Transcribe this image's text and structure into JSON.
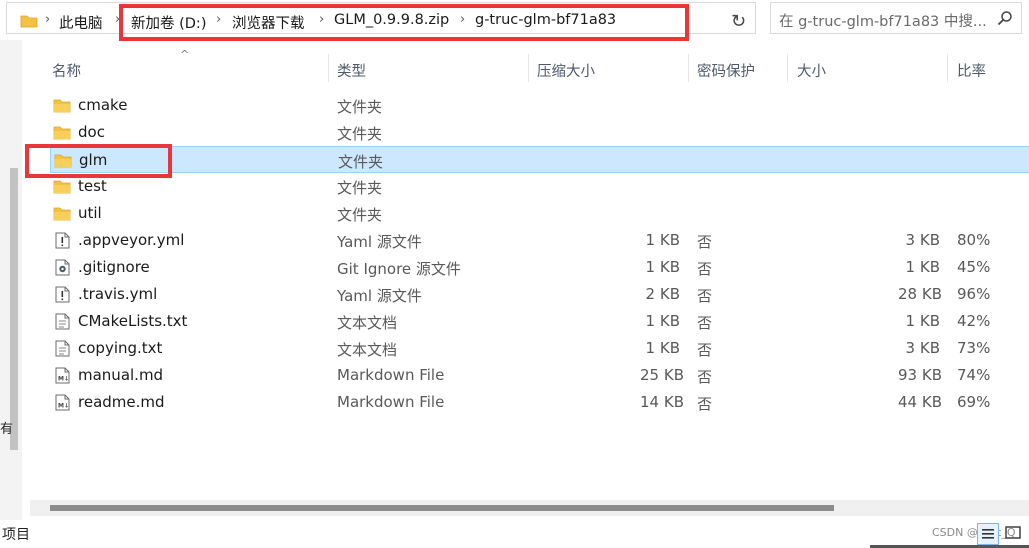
{
  "address": {
    "root": "此电脑",
    "crumbs": [
      "新加卷 (D:)",
      "浏览器下载",
      "GLM_0.9.9.8.zip",
      "g-truc-glm-bf71a83"
    ]
  },
  "search": {
    "placeholder": "在 g-truc-glm-bf71a83 中搜..."
  },
  "columns": {
    "name": "名称",
    "type": "类型",
    "compressed": "压缩大小",
    "password": "密码保护",
    "size": "大小",
    "ratio": "比率"
  },
  "rows": [
    {
      "name": "cmake",
      "type": "文件夹",
      "csize": "",
      "pw": "",
      "size": "",
      "ratio": "",
      "icon": "folder-icon"
    },
    {
      "name": "doc",
      "type": "文件夹",
      "csize": "",
      "pw": "",
      "size": "",
      "ratio": "",
      "icon": "folder-icon"
    },
    {
      "name": "glm",
      "type": "文件夹",
      "csize": "",
      "pw": "",
      "size": "",
      "ratio": "",
      "icon": "folder-icon",
      "selected": true
    },
    {
      "name": "test",
      "type": "文件夹",
      "csize": "",
      "pw": "",
      "size": "",
      "ratio": "",
      "icon": "folder-icon"
    },
    {
      "name": "util",
      "type": "文件夹",
      "csize": "",
      "pw": "",
      "size": "",
      "ratio": "",
      "icon": "folder-icon"
    },
    {
      "name": ".appveyor.yml",
      "type": "Yaml 源文件",
      "csize": "1 KB",
      "pw": "否",
      "size": "3 KB",
      "ratio": "80%",
      "icon": "yaml-file-icon"
    },
    {
      "name": ".gitignore",
      "type": "Git Ignore 源文件",
      "csize": "1 KB",
      "pw": "否",
      "size": "1 KB",
      "ratio": "45%",
      "icon": "gear-file-icon"
    },
    {
      "name": ".travis.yml",
      "type": "Yaml 源文件",
      "csize": "2 KB",
      "pw": "否",
      "size": "28 KB",
      "ratio": "96%",
      "icon": "yaml-file-icon"
    },
    {
      "name": "CMakeLists.txt",
      "type": "文本文档",
      "csize": "1 KB",
      "pw": "否",
      "size": "1 KB",
      "ratio": "42%",
      "icon": "text-file-icon"
    },
    {
      "name": "copying.txt",
      "type": "文本文档",
      "csize": "1 KB",
      "pw": "否",
      "size": "3 KB",
      "ratio": "73%",
      "icon": "text-file-icon"
    },
    {
      "name": "manual.md",
      "type": "Markdown File",
      "csize": "25 KB",
      "pw": "否",
      "size": "93 KB",
      "ratio": "74%",
      "icon": "markdown-file-icon"
    },
    {
      "name": "readme.md",
      "type": "Markdown File",
      "csize": "14 KB",
      "pw": "否",
      "size": "44 KB",
      "ratio": "69%",
      "icon": "markdown-file-icon"
    }
  ],
  "sidebar_fragment": "有",
  "status": {
    "text": "项目",
    "watermark": "CSDN @Vast_Q"
  },
  "colors": {
    "highlight": "#e8363a",
    "selection": "#cce8ff",
    "folder": "#f3c242"
  }
}
